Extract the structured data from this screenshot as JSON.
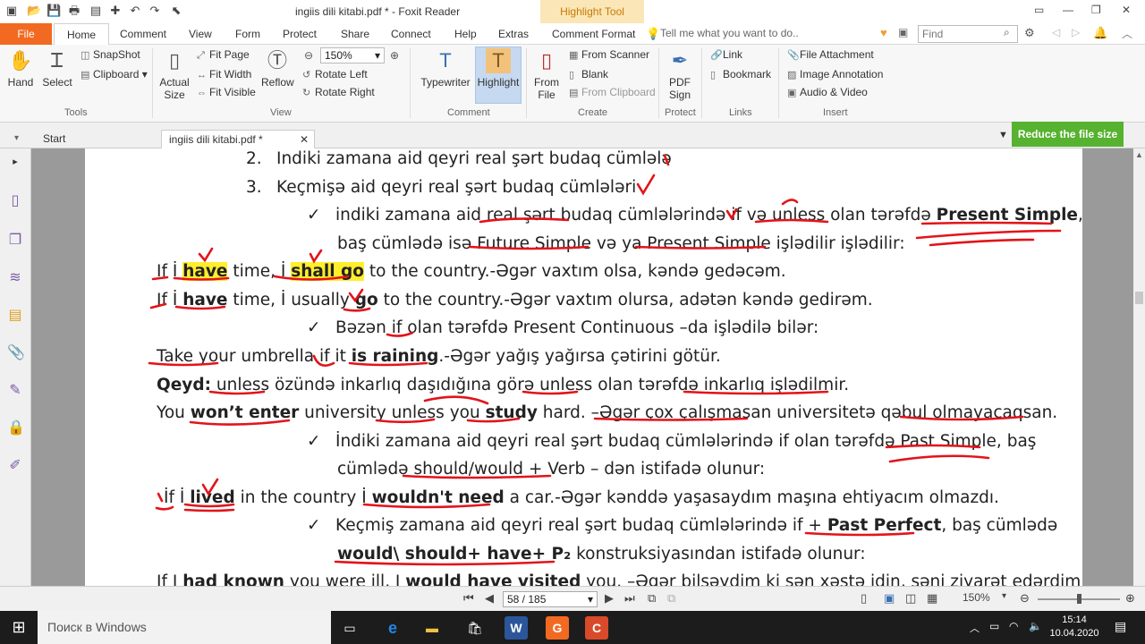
{
  "window": {
    "title": "ingiis dili kitabi.pdf * - Foxit Reader",
    "context_tab": "Highlight Tool"
  },
  "menu": {
    "file": "File",
    "tabs": [
      "Home",
      "Comment",
      "View",
      "Form",
      "Protect",
      "Share",
      "Connect",
      "Help",
      "Extras",
      "Comment Format"
    ],
    "tell_me": "Tell me what you want to do..",
    "find_placeholder": "Find"
  },
  "ribbon": {
    "tools": {
      "hand": "Hand",
      "select": "Select",
      "snapshot": "SnapShot",
      "clipboard": "Clipboard",
      "group": "Tools"
    },
    "view": {
      "actual_size": "Actual Size",
      "fit_page": "Fit Page",
      "fit_width": "Fit Width",
      "fit_visible": "Fit Visible",
      "reflow": "Reflow",
      "zoom": "150%",
      "rotate_left": "Rotate Left",
      "rotate_right": "Rotate Right",
      "group": "View"
    },
    "comment": {
      "typewriter": "Typewriter",
      "highlight": "Highlight",
      "group": "Comment"
    },
    "create": {
      "from_file": "From File",
      "from_scanner": "From Scanner",
      "blank": "Blank",
      "from_clipboard": "From Clipboard",
      "group": "Create"
    },
    "protect": {
      "pdf_sign": "PDF Sign",
      "group": "Protect"
    },
    "links": {
      "link": "Link",
      "bookmark": "Bookmark",
      "group": "Links"
    },
    "insert": {
      "file_attachment": "File Attachment",
      "image_annotation": "Image Annotation",
      "audio_video": "Audio & Video",
      "group": "Insert"
    }
  },
  "tabs": {
    "start": "Start",
    "doc": "ingiis dili kitabi.pdf *",
    "reduce": "Reduce the file size"
  },
  "doc": {
    "l1": "Indiki zamana aid qeyri real şərt budaq cümlələ",
    "l2": "Keçmişə aid qeyri real şərt budaq cümlələri",
    "n2": "2.",
    "n3": "3.",
    "l3a": "indiki zamana aid real şərt budaq cümlələrində if və unless olan tərəfdə ",
    "l3b": "Present Simple",
    "l3c": ",",
    "l4": "baş cümlədə isə Future Simple və ya Present Simple işlədilir işlədilir:",
    "l5a": "If İ ",
    "l5b": "have",
    "l5c": " time, İ ",
    "l5d": "shall go",
    "l5e": " to the country.-Əgər vaxtım olsa, kəndə gedəcəm.",
    "l6a": "If İ ",
    "l6b": "have",
    "l6c": " time, İ usually ",
    "l6d": "go",
    "l6e": " to the country.-Əgər vaxtım olursa, adətən kəndə gedirəm.",
    "l7": "Bəzən if olan tərəfdə Present Continuous –da işlədilə bilər:",
    "l8a": "Take your umbrella if it ",
    "l8b": "is raining",
    "l8c": ".-Əgər yağış yağırsa çətirini götür.",
    "l9a": "Qeyd:",
    "l9b": " unless özündə inkarlıq daşıdığına görə unless olan tərəfdə inkarlıq işlədilmir.",
    "l10a": "You ",
    "l10b": "won’t enter",
    "l10c": " university unless you ",
    "l10d": "study",
    "l10e": " hard. –Əgər çox çalışmasan universitetə qəbul olmayacaqsan.",
    "l11": "İndiki zamana aid qeyri real şərt budaq cümlələrində if olan tərəfdə Past Simple, baş",
    "l12": "cümlədə should/would + Verb – dən istifadə olunur:",
    "l13a": "İf İ ",
    "l13b": "lived",
    "l13c": " in the country İ  ",
    "l13d": "wouldn't need",
    "l13e": " a car.-Əgər kənddə yaşasaydım maşına ehtiyacım olmazdı.",
    "l14a": "Keçmiş zamana aid qeyri real şərt budaq cümlələrində if + ",
    "l14b": "Past Perfect",
    "l14c": ", baş cümlədə",
    "l15a": "would\\ should+ have+ P₂",
    "l15b": " konstruksiyasından istifadə olunur:",
    "l16a": "If I ",
    "l16b": "had known",
    "l16c": " you were ill, I ",
    "l16d": "would have visited",
    "l16e": " you. –Əgər bilsəydim ki sən xəstə idin, səni ziyarət edərdim."
  },
  "status": {
    "page": "58 / 185",
    "zoom": "150%"
  },
  "taskbar": {
    "search": "Поиск в Windows",
    "time": "15:14",
    "date": "10.04.2020"
  }
}
